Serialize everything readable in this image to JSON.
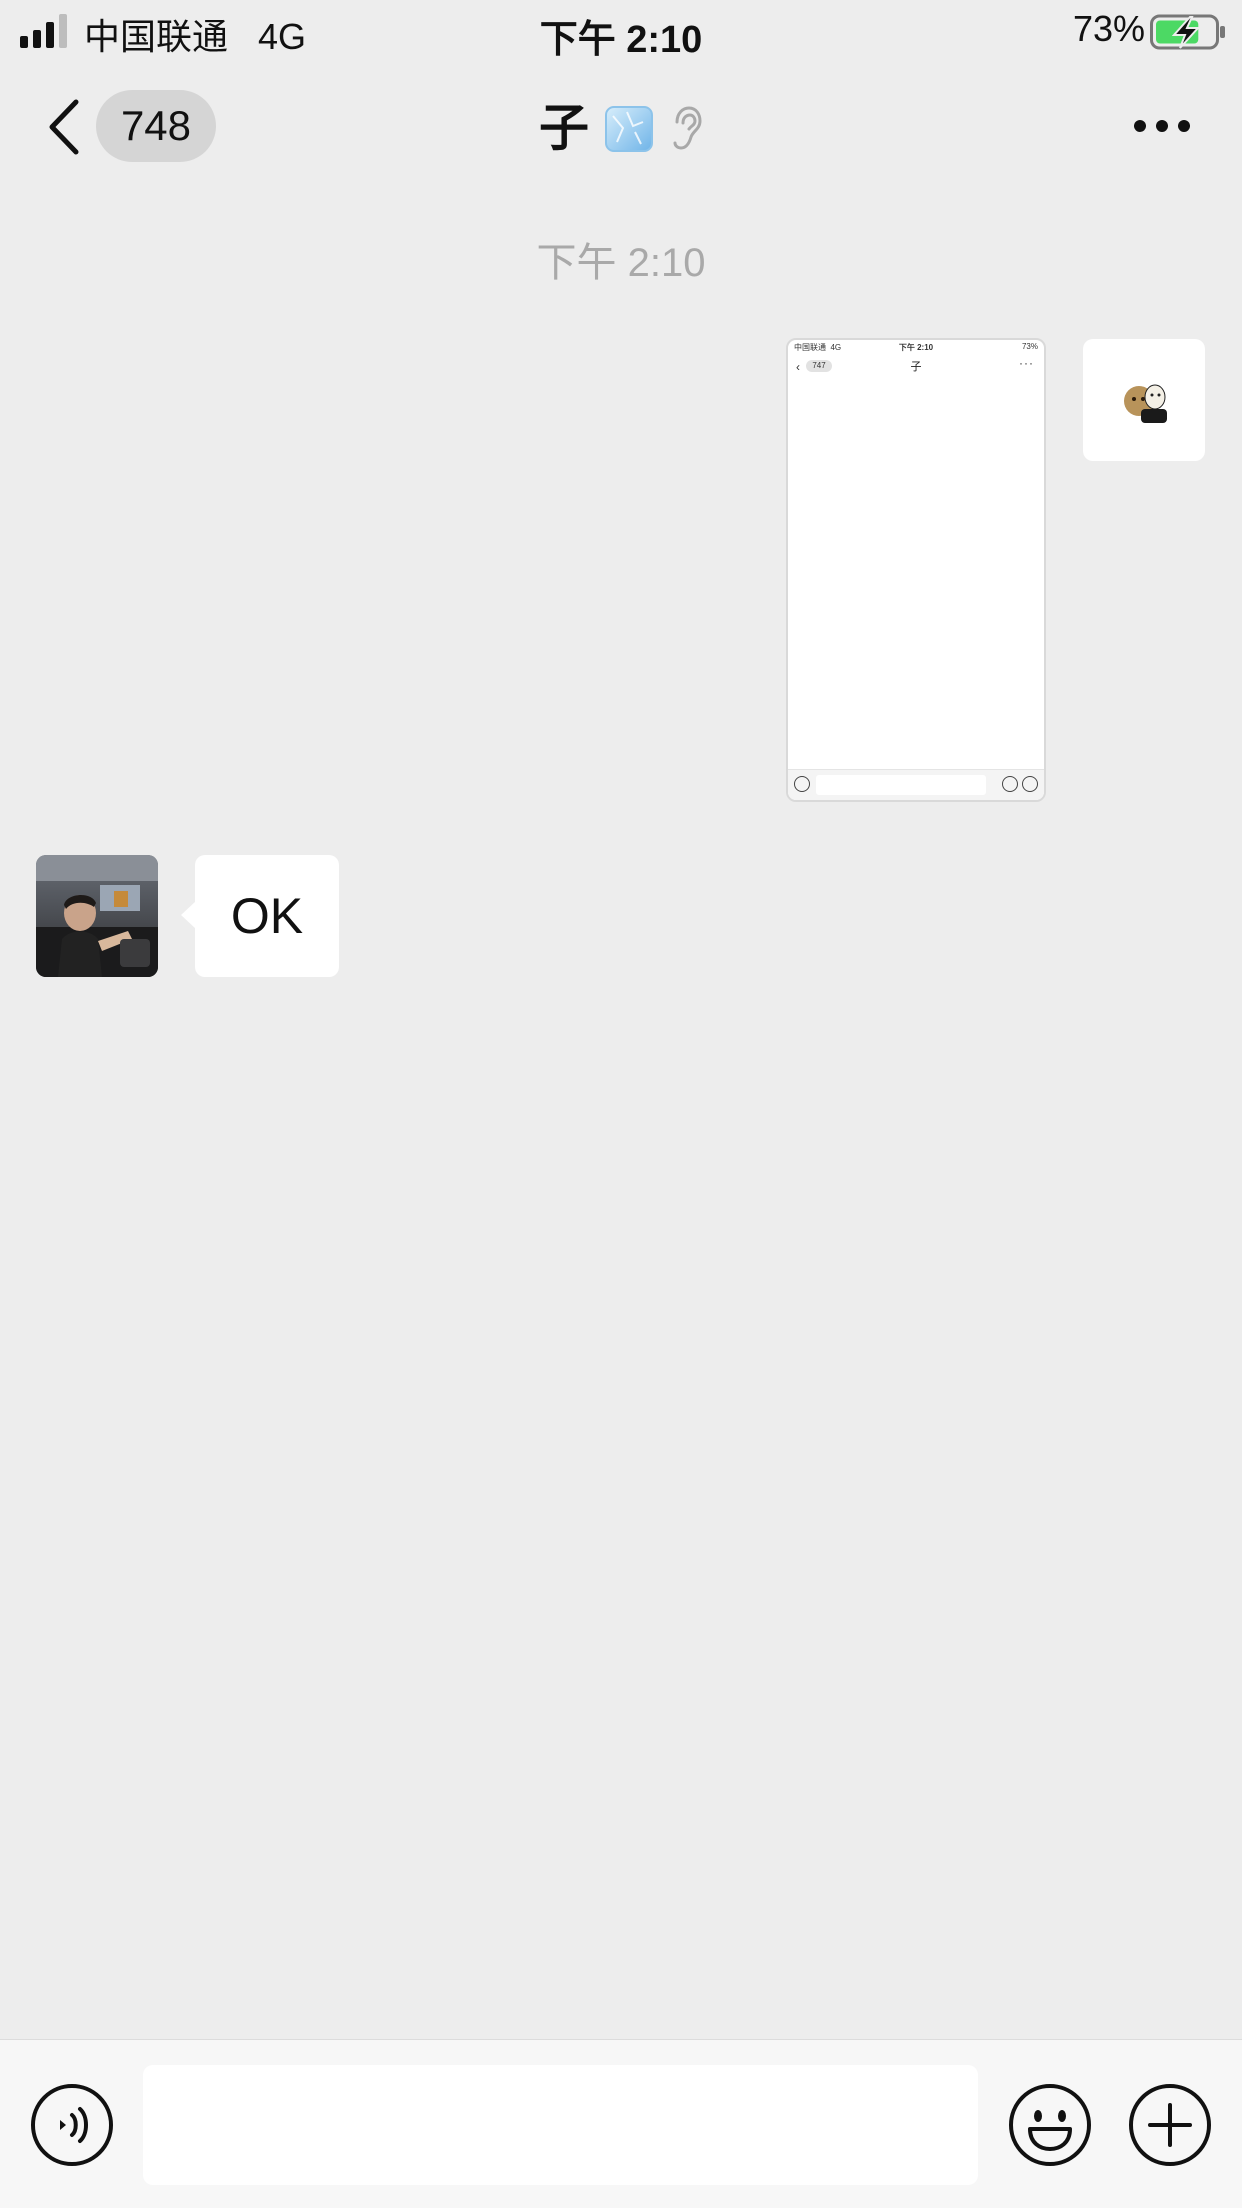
{
  "status_bar": {
    "carrier": "中国联通   4G",
    "time": "下午 2:10",
    "battery_percent": "73%",
    "battery_level": 0.73,
    "battery_color": "#4CD964",
    "charging": true
  },
  "nav": {
    "unread_count": "748",
    "title": "子",
    "title_icons": [
      "ice-cube-icon",
      "ear-icon"
    ],
    "more_icon": "more-dots-icon"
  },
  "messages": {
    "timestamp": "下午 2:10",
    "sent_image": {
      "status_carrier": "中国联通  4G",
      "status_time": "下午 2:10",
      "status_battery": "73%",
      "unread_count": "747",
      "title": "子"
    },
    "received": {
      "text": "OK"
    }
  },
  "input_bar": {
    "placeholder": "",
    "voice_icon": "voice-icon",
    "emoji_icon": "emoji-icon",
    "plus_icon": "plus-icon"
  },
  "colors": {
    "background": "#EDEDED",
    "bubble": "#FFFFFF",
    "timestamp_text": "#A9A9A9",
    "unread_pill": "#D5D5D5"
  }
}
